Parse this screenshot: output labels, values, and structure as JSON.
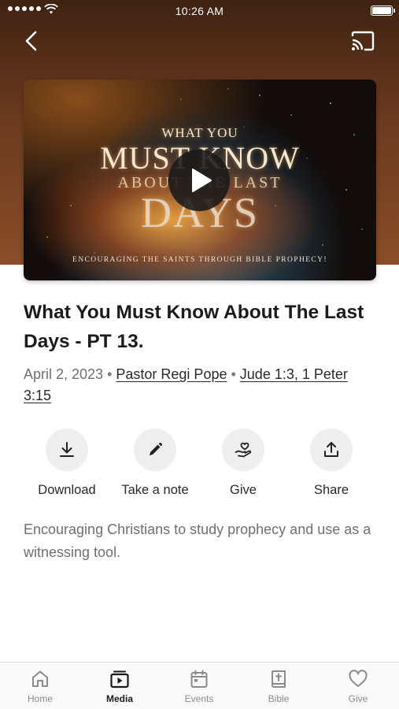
{
  "status_bar": {
    "time": "10:26 AM"
  },
  "header": {
    "back_icon": "chevron-left-icon",
    "cast_icon": "cast-icon"
  },
  "video": {
    "thumbnail_lines": [
      "WHAT YOU",
      "MUST KNOW",
      "ABOUT THE LAST",
      "DAYS"
    ],
    "tagline": "ENCOURAGING THE SAINTS THROUGH BIBLE PROPHECY!",
    "play_icon": "play-icon"
  },
  "sermon": {
    "title": "What You Must Know About The Last Days - PT 13.",
    "date": "April 2, 2023",
    "speaker": "Pastor Regi Pope",
    "scripture": "Jude 1:3, 1 Peter 3:15",
    "description": "Encouraging Christians to study prophecy and use as a witnessing tool."
  },
  "actions": [
    {
      "label": "Download",
      "icon": "download-icon"
    },
    {
      "label": "Take a note",
      "icon": "pencil-icon"
    },
    {
      "label": "Give",
      "icon": "give-heart-hand-icon"
    },
    {
      "label": "Share",
      "icon": "share-icon"
    }
  ],
  "tabs": [
    {
      "label": "Home",
      "icon": "home-icon",
      "active": false
    },
    {
      "label": "Media",
      "icon": "media-icon",
      "active": true
    },
    {
      "label": "Events",
      "icon": "calendar-icon",
      "active": false
    },
    {
      "label": "Bible",
      "icon": "bible-icon",
      "active": false
    },
    {
      "label": "Give",
      "icon": "heart-icon",
      "active": false
    }
  ],
  "colors": {
    "header_brown": "#6b3a1f",
    "action_circle": "#eeeeee",
    "tab_active": "#1b1b1b",
    "tab_inactive": "#8b8b8b"
  }
}
